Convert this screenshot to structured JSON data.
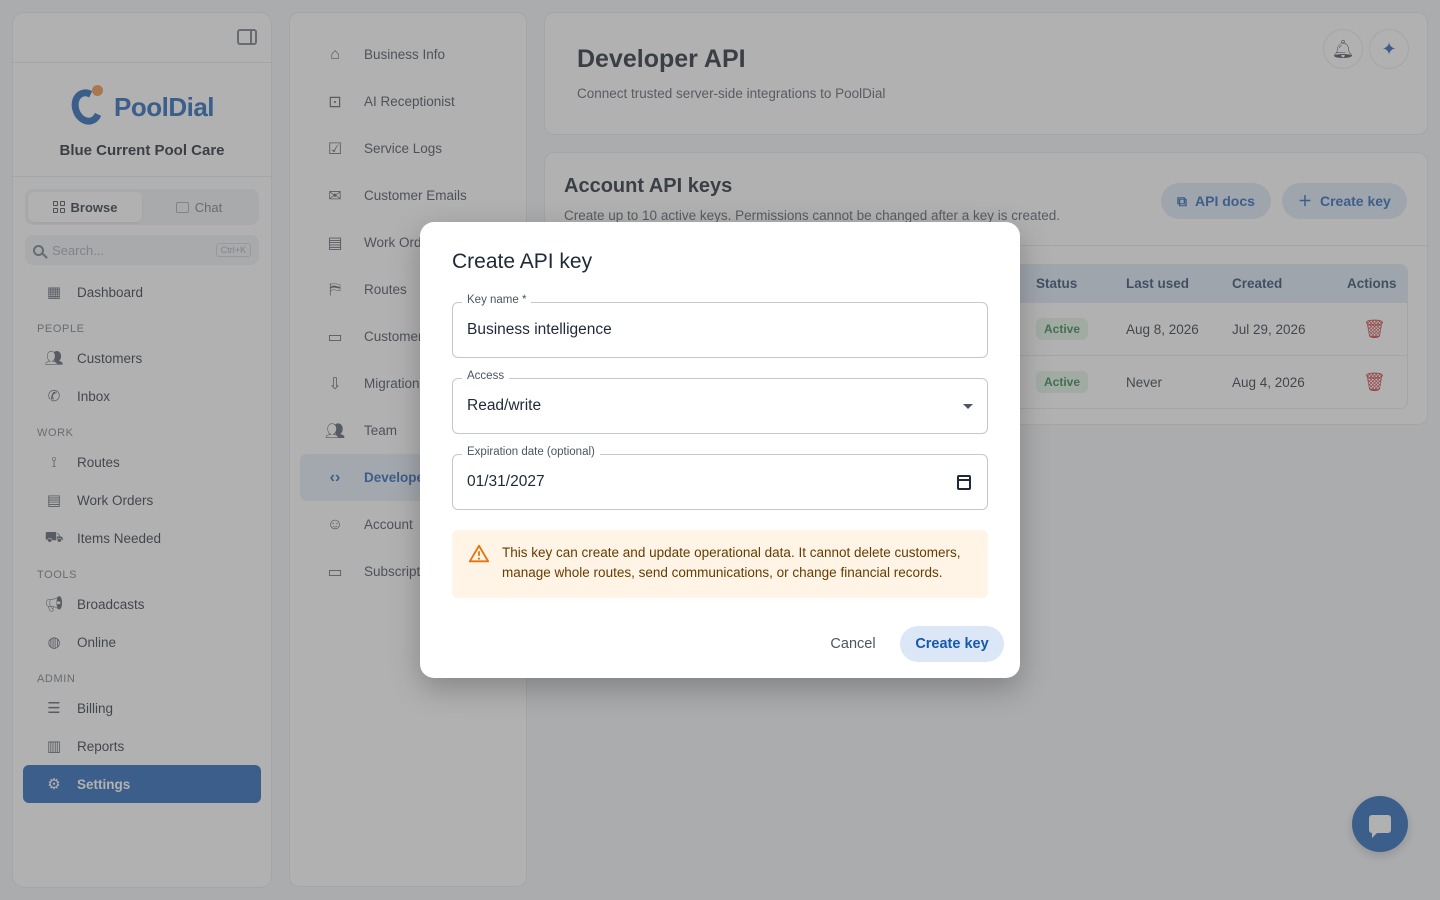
{
  "sidebar": {
    "business_name": "Blue Current Pool Care",
    "logo_text": "PoolDial",
    "mode_tabs": [
      {
        "label": "Browse",
        "icon": "grid-icon"
      },
      {
        "label": "Chat",
        "icon": "chat-icon"
      }
    ],
    "search": {
      "placeholder": "Search...",
      "shortcut": "Ctrl+K"
    },
    "dashboard": {
      "label": "Dashboard",
      "icon": "dashboard-icon"
    },
    "sections": {
      "people": "PEOPLE",
      "work": "WORK",
      "tools": "TOOLS",
      "admin": "ADMIN"
    },
    "people_items": [
      {
        "label": "Customers",
        "icon": "people-icon"
      },
      {
        "label": "Inbox",
        "icon": "phone-icon"
      }
    ],
    "work_items": [
      {
        "label": "Routes",
        "icon": "route-icon"
      },
      {
        "label": "Work Orders",
        "icon": "clipboard-icon"
      },
      {
        "label": "Items Needed",
        "icon": "cart-icon"
      }
    ],
    "tools_items": [
      {
        "label": "Broadcasts",
        "icon": "megaphone-icon"
      },
      {
        "label": "Online",
        "icon": "globe-icon"
      }
    ],
    "admin_items": [
      {
        "label": "Billing",
        "icon": "list-icon"
      },
      {
        "label": "Reports",
        "icon": "chart-icon"
      },
      {
        "label": "Settings",
        "icon": "gear-icon",
        "active": true
      }
    ]
  },
  "settings_nav": [
    {
      "label": "Business Info",
      "icon": "store-icon"
    },
    {
      "label": "AI Receptionist",
      "icon": "robot-icon"
    },
    {
      "label": "Service Logs",
      "icon": "checklist-icon"
    },
    {
      "label": "Customer Emails",
      "icon": "mail-icon"
    },
    {
      "label": "Work Orders",
      "icon": "clipboard-icon"
    },
    {
      "label": "Routes",
      "icon": "map-icon"
    },
    {
      "label": "Customer",
      "icon": "card-icon"
    },
    {
      "label": "Migration",
      "icon": "import-icon"
    },
    {
      "label": "Team",
      "icon": "people-icon"
    },
    {
      "label": "Developer",
      "icon": "code-icon",
      "active": true
    },
    {
      "label": "Account",
      "icon": "account-icon"
    },
    {
      "label": "Subscription",
      "icon": "card-icon"
    }
  ],
  "header": {
    "title": "Developer API",
    "subtitle": "Connect trusted server-side integrations to PoolDial"
  },
  "keys_card": {
    "title": "Account API keys",
    "subtitle": "Create up to 10 active keys. Permissions cannot be changed after a key is created.",
    "api_docs_label": "API docs",
    "create_key_label": "Create key",
    "columns": {
      "status": "Status",
      "last_used": "Last used",
      "created": "Created",
      "actions": "Actions"
    },
    "rows": [
      {
        "status": "Active",
        "last_used": "Aug 8, 2026",
        "created": "Jul 29, 2026"
      },
      {
        "status": "Active",
        "last_used": "Never",
        "created": "Aug 4, 2026"
      }
    ]
  },
  "modal": {
    "title": "Create API key",
    "key_name": {
      "label": "Key name *",
      "value": "Business intelligence"
    },
    "access": {
      "label": "Access",
      "value": "Read/write"
    },
    "expiration": {
      "label": "Expiration date (optional)",
      "value": "01/31/2027"
    },
    "warning": "This key can create and update operational data. It cannot delete customers, manage whole routes, send communications, or change financial records.",
    "cancel_label": "Cancel",
    "create_label": "Create key"
  },
  "colors": {
    "primary": "#1558b0",
    "accent_light": "#dbe7f6",
    "danger": "#c62828",
    "warning_bg": "#fff4e5",
    "success": "#1f7a3a"
  }
}
